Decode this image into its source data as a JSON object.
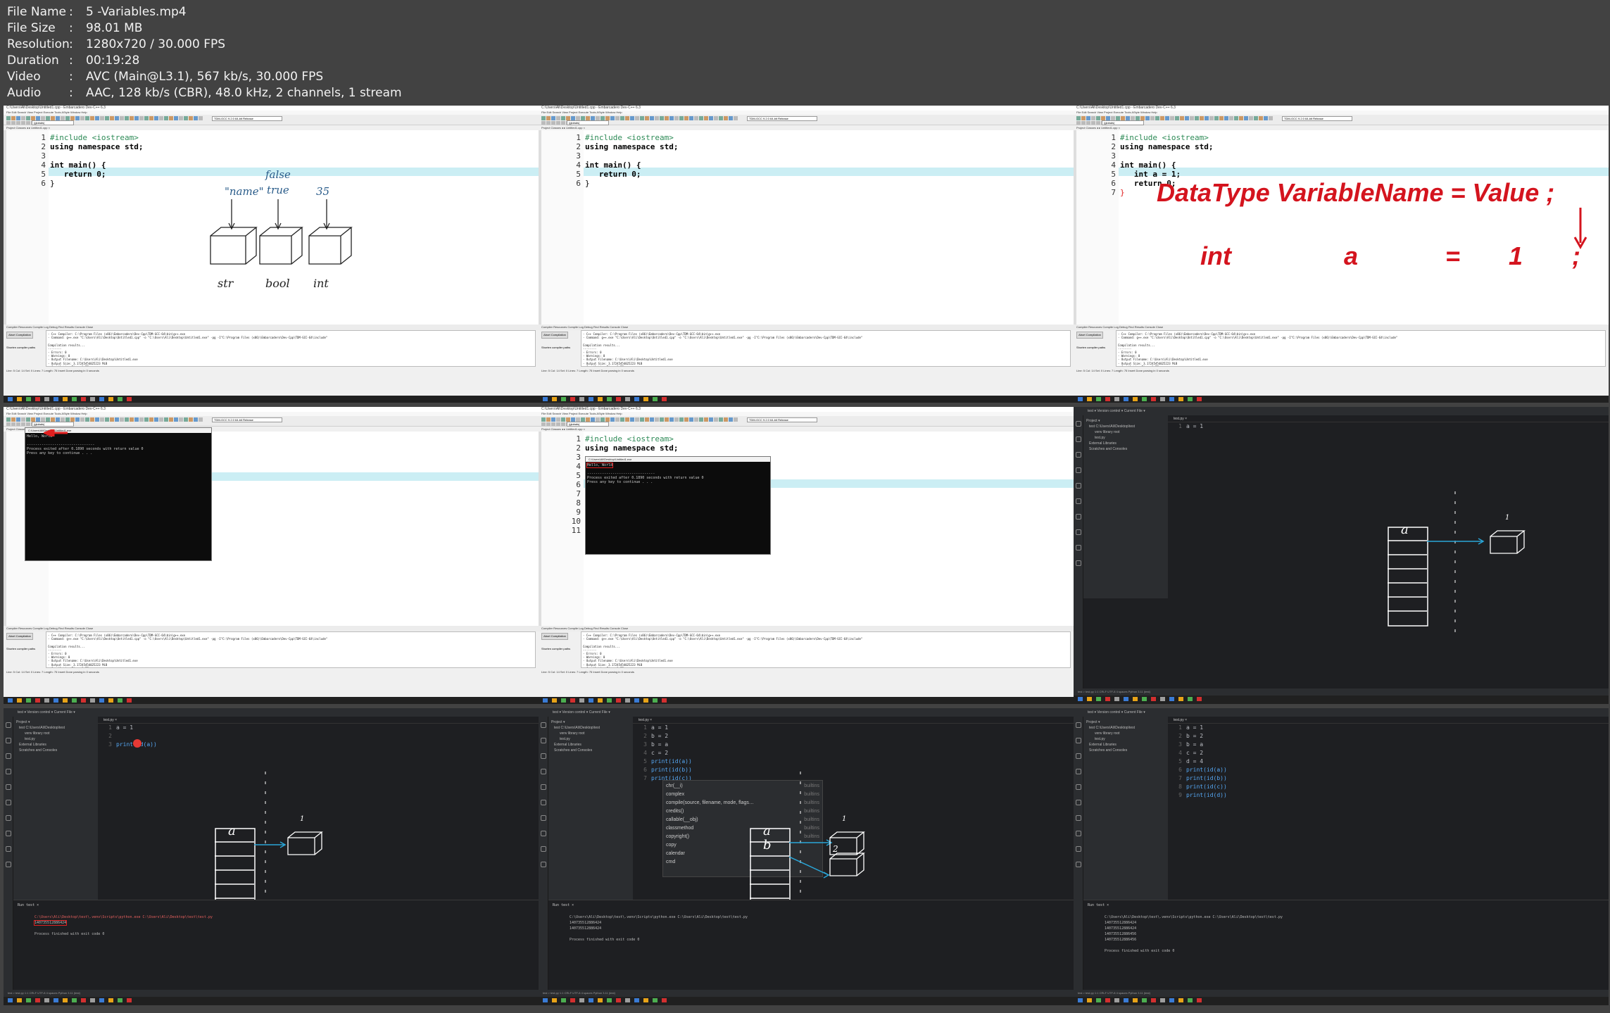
{
  "media_info": [
    {
      "key": "File Name",
      "value": "5 -Variables.mp4"
    },
    {
      "key": "File Size",
      "value": "98.01 MB"
    },
    {
      "key": "Resolution",
      "value": "1280x720 / 30.000 FPS"
    },
    {
      "key": "Duration",
      "value": "00:19:28"
    },
    {
      "key": "Video",
      "value": "AVC (Main@L3.1), 567 kb/s, 30.000 FPS"
    },
    {
      "key": "Audio",
      "value": "AAC, 128 kb/s (CBR), 48.0 kHz, 2 channels, 1 stream"
    }
  ],
  "separator": ":",
  "devcpp": {
    "title": "C:\\Users\\Ali\\Desktop\\Untitled1.cpp - Embarcadero Dev-C++ 6.3",
    "menu": "File  Edit  Search  View  Project  Execute  Tools  AStyle  Window  Help",
    "compiler": "TDM-GCC 9.2.0 64-bit Release",
    "globals": "(globals)",
    "tabs": "Project  Classes  ◂ ▸  Untitled1.cpp  ×",
    "bottom_tabs": "Compiler  Resources  Compile Log  Debug  Find Results  Console  Close",
    "abort": "Abort Compilation",
    "shorten": "Shorten compiler paths",
    "log": "- C++ Compiler: C:\\Program Files (x86)\\Embarcadero\\Dev-Cpp\\TDM-GCC-64\\bin\\g++.exe\n- Command: g++.exe \"C:\\Users\\Ali\\Desktop\\Untitled1.cpp\" -o \"C:\\Users\\Ali\\Desktop\\Untitled1.exe\" -pg -I\"C:\\Program Files (x86)\\Embarcadero\\Dev-Cpp\\TDM-GCC-64\\include\"\n\nCompilation results...\n--------\n- Errors: 0\n- Warnings: 0\n- Output Filename: C:\\Users\\Ali\\Desktop\\Untitled1.exe\n- Output Size: 3.17245454025223 MiB\n- Compilation Time: 1.77s",
    "status": "Line: 5   Col: 14   Sel: 0   Lines: 7   Length: 75   Insert   Done parsing in 0 seconds",
    "console_title": "C:\\Users\\Ali\\Desktop\\Untitled1.exe",
    "console_hello": "Hello, World",
    "console_body": "--------------------------------\nProcess exited after 0.1890 seconds with return value 0\nPress any key to continue . . ."
  },
  "code": {
    "l1": "#include <iostream>",
    "l2": "using namespace std;",
    "l4": "int main() {",
    "l5_ret": "return 0;",
    "l5_decl": "int a = 1;",
    "l6_ret": "return 0;",
    "close": "}"
  },
  "sketch1": {
    "name": "\"name\"",
    "false": "false",
    "true": "true",
    "num": "35",
    "str": "str",
    "bool": "bool",
    "int": "int"
  },
  "formula": {
    "heading": "DataType VariableName = Value ;",
    "dt": "int",
    "vn": "a",
    "eq": "=",
    "val": "1",
    "semi": ";"
  },
  "pycharm": {
    "top": "test  ▾    Version control  ▾                                                     Current File  ▾",
    "project_title": "Project  ▾",
    "tree": [
      "test  C:\\Users\\Ali\\Desktop\\test",
      "venv  library root",
      "test.py",
      "External Libraries",
      "Scratches and Consoles"
    ],
    "tab": "test.py  ×",
    "run_title": "Run    test  ×",
    "run_cmd": "C:\\Users\\Ali\\Desktop\\test\\.venv\\Scripts\\python.exe C:\\Users\\Ali\\Desktop\\test\\test.py",
    "out1": "140735512886424",
    "out2": "140735512886456",
    "finish": "Process finished with exit code 0",
    "status": "test  >  test.py                                                         1:1   CRLF   UTF-8   4 spaces   Python 3.11 (test)",
    "l_a1": "a = 1",
    "l_b2": "b = 2",
    "l_ba": "b = a",
    "l_c2": "c = 2",
    "l_d4": "d = 4",
    "p_a": "print(id(a))",
    "p_b": "print(id(b))",
    "p_c": "print(id(c))",
    "p_d": "print(id(d))",
    "p_partial": "print(id(c))",
    "sketch_a": "a",
    "sketch_b": "b",
    "one": "1",
    "two": "2",
    "ac": [
      {
        "n": "chr(__i)",
        "t": "builtins"
      },
      {
        "n": "complex",
        "t": "builtins"
      },
      {
        "n": "compile(source, filename, mode, flags…",
        "t": "builtins"
      },
      {
        "n": "credits()",
        "t": "builtins"
      },
      {
        "n": "callable(__obj)",
        "t": "builtins"
      },
      {
        "n": "classmethod",
        "t": "builtins"
      },
      {
        "n": "copyright()",
        "t": "builtins"
      },
      {
        "n": "copy",
        "t": ""
      },
      {
        "n": "calendar",
        "t": ""
      },
      {
        "n": "cmd",
        "t": ""
      }
    ]
  }
}
